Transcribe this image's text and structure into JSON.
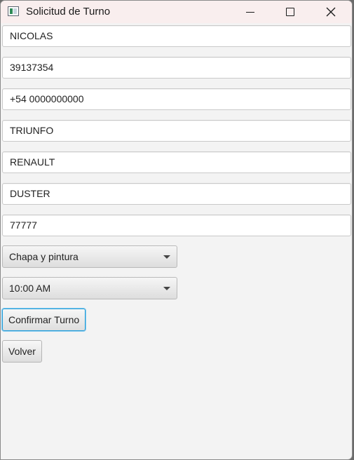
{
  "window": {
    "title": "Solicitud de Turno",
    "controls": {
      "minimize": "minimize-icon",
      "maximize": "maximize-icon",
      "close": "close-icon"
    }
  },
  "form": {
    "fields": [
      {
        "value": "NICOLAS"
      },
      {
        "value": "39137354"
      },
      {
        "value": "+54 0000000000"
      },
      {
        "value": "TRIUNFO"
      },
      {
        "value": "RENAULT"
      },
      {
        "value": "DUSTER"
      },
      {
        "value": "77777"
      }
    ],
    "service_select": {
      "selected": "Chapa y pintura"
    },
    "time_select": {
      "selected": "10:00 AM"
    },
    "confirm_label": "Confirmar Turno",
    "back_label": "Volver"
  },
  "colors": {
    "focus_accent": "#2a9fd8",
    "titlebar_bg": "#f9eeee",
    "window_bg": "#f3f3f3"
  }
}
